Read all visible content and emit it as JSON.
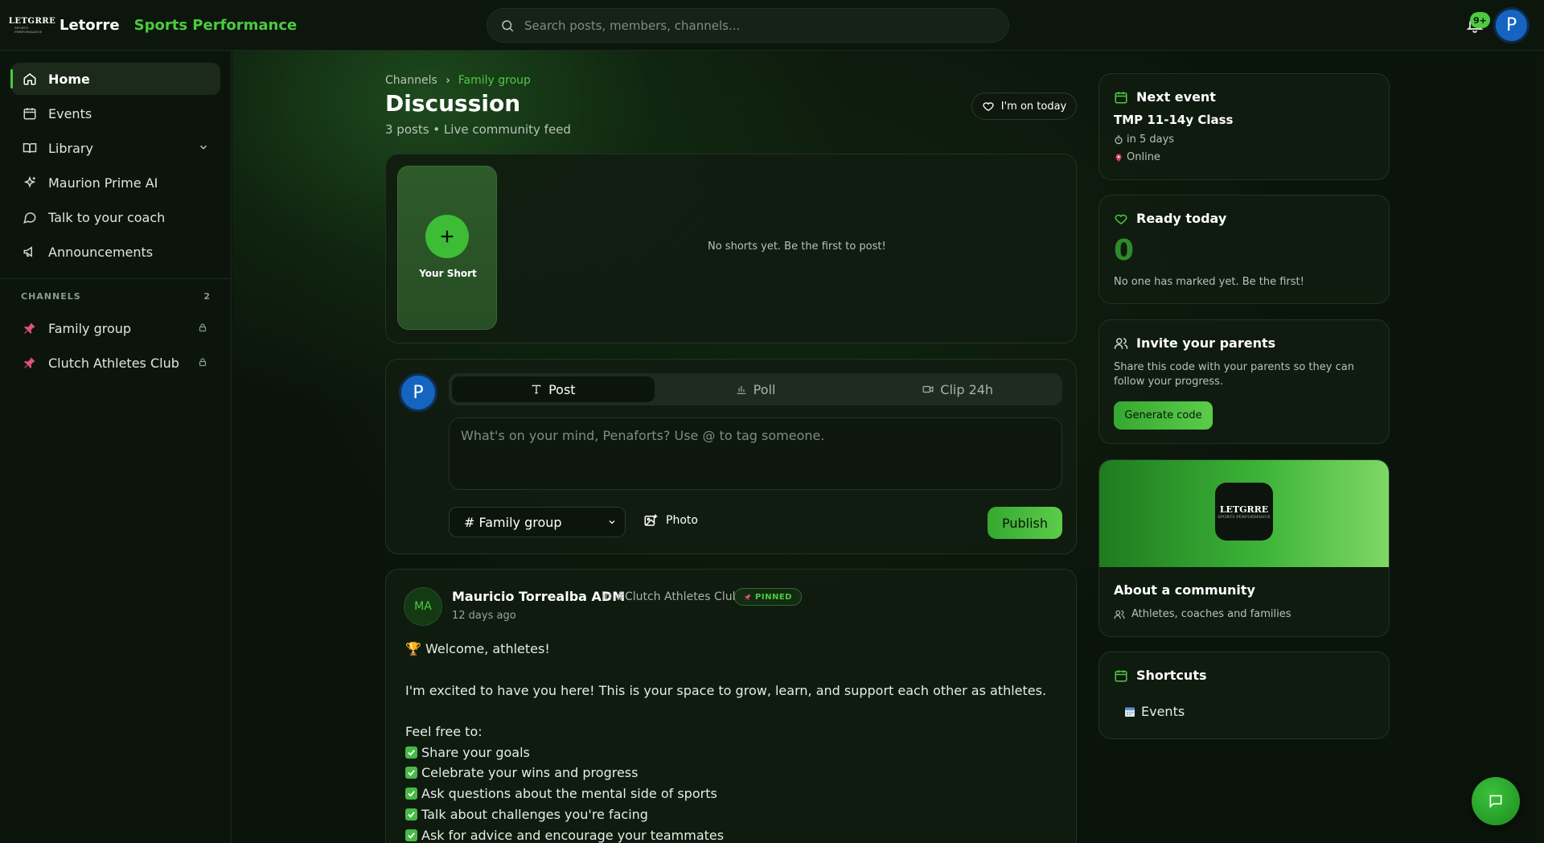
{
  "app": {
    "brand_name": "Letorre",
    "brand_accent": "Sports Performance",
    "logo_text": "LETGRRE"
  },
  "search": {
    "placeholder": "Search posts, members, channels..."
  },
  "notifications": {
    "badge": "9+"
  },
  "user": {
    "initial": "P"
  },
  "sidebar": {
    "items": [
      {
        "label": "Home",
        "icon": "home-icon",
        "active": true
      },
      {
        "label": "Events",
        "icon": "calendar-icon"
      },
      {
        "label": "Library",
        "icon": "book-icon"
      },
      {
        "label": "Maurion Prime AI",
        "icon": "sparkles-icon"
      },
      {
        "label": "Talk to your coach",
        "icon": "chat-bubble-icon"
      },
      {
        "label": "Announcements",
        "icon": "megaphone-icon"
      }
    ],
    "channels_header": "CHANNELS",
    "channels_count": "2",
    "channels": [
      {
        "label": "Family group",
        "icon": "pin-icon"
      },
      {
        "label": "Clutch Athletes Club",
        "icon": "pin-icon"
      }
    ]
  },
  "header": {
    "breadcrumb_root": "Channels",
    "breadcrumb_current": "Family group",
    "title": "Discussion",
    "posts_count": "3 posts",
    "feed_label": "Live community feed",
    "on_today_label": "I'm on today"
  },
  "shorts": {
    "your_short_label": "Your Short",
    "empty_text": "No shorts yet. Be the first to post!"
  },
  "composer": {
    "avatar_initial": "P",
    "tabs": [
      {
        "label": "Post",
        "icon": "text-icon",
        "active": true
      },
      {
        "label": "Poll",
        "icon": "bar-chart-icon"
      },
      {
        "label": "Clip 24h",
        "icon": "video-icon"
      }
    ],
    "placeholder": "What's on your mind, Penaforts? Use @ to tag someone.",
    "channel_selected": "# Family group",
    "photo_label": "Photo",
    "publish_label": "Publish"
  },
  "post": {
    "avatar_initials": "MA",
    "author": "Mauricio Torrealba ADM",
    "channel": "in #Clutch Athletes Club",
    "pinned_label": "PINNED",
    "time": "12 days ago",
    "greeting": "🏆 Welcome, athletes!",
    "intro": "I'm excited to have you here! This is your space to grow, learn, and support each other as athletes.",
    "list_intro": "Feel free to:",
    "list": [
      "Share your goals",
      "Celebrate your wins and progress",
      "Ask questions about the mental side of sports",
      "Talk about challenges you're facing",
      "Ask for advice and encourage your teammates"
    ]
  },
  "right": {
    "next_event": {
      "title": "Next event",
      "event_name": "TMP 11-14y Class",
      "when": "in 5 days",
      "where": "Online"
    },
    "ready_today": {
      "title": "Ready today",
      "count": "0",
      "note": "No one has marked yet. Be the first!"
    },
    "invite": {
      "title": "Invite your parents",
      "text": "Share this code with your parents so they can follow your progress.",
      "button": "Generate code"
    },
    "about": {
      "title": "About a community",
      "subtitle": "Athletes, coaches and families"
    },
    "shortcuts": {
      "title": "Shortcuts",
      "items": [
        {
          "label": "Events",
          "icon": "calendar-emoji-icon"
        }
      ]
    }
  },
  "colors": {
    "accent": "#4ccb3f",
    "background": "#0b140b",
    "card": "#101c10",
    "avatar_blue": "#1565c0"
  }
}
